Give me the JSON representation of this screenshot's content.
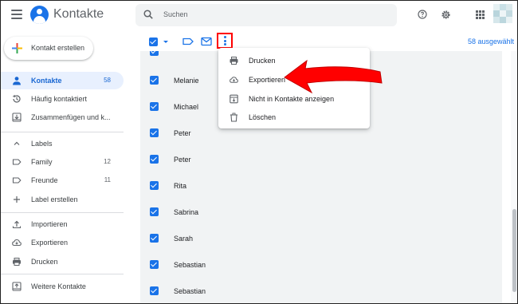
{
  "header": {
    "title": "Kontakte",
    "search_placeholder": "Suchen",
    "icons": [
      "menu-icon",
      "contacts-logo",
      "search-icon",
      "help-icon",
      "gear-icon",
      "apps-icon",
      "avatar"
    ]
  },
  "sidebar": {
    "create_label": "Kontakt erstellen",
    "items": [
      {
        "label": "Kontakte",
        "count": "58",
        "icon": "person-icon",
        "active": true
      },
      {
        "label": "Häufig kontaktiert",
        "count": "",
        "icon": "history-icon"
      },
      {
        "label": "Zusammenfügen und k...",
        "count": "",
        "icon": "merge-icon"
      },
      {
        "label": "Labels",
        "count": "",
        "icon": "chevron-up-icon"
      },
      {
        "label": "Family",
        "count": "12",
        "icon": "label-icon"
      },
      {
        "label": "Freunde",
        "count": "11",
        "icon": "label-icon"
      },
      {
        "label": "Label erstellen",
        "count": "",
        "icon": "plus-icon"
      },
      {
        "label": "Importieren",
        "count": "",
        "icon": "upload-icon"
      },
      {
        "label": "Exportieren",
        "count": "",
        "icon": "cloud-download-icon"
      },
      {
        "label": "Drucken",
        "count": "",
        "icon": "print-icon"
      },
      {
        "label": "Weitere Kontakte",
        "count": "",
        "icon": "other-contacts-icon"
      }
    ]
  },
  "toolbar": {
    "selected_text": "58 ausgewählt"
  },
  "contacts": [
    {
      "name": "Melanie"
    },
    {
      "name": "Michael"
    },
    {
      "name": "Peter"
    },
    {
      "name": "Peter"
    },
    {
      "name": "Rita"
    },
    {
      "name": "Sabrina"
    },
    {
      "name": "Sarah"
    },
    {
      "name": "Sebastian"
    },
    {
      "name": "Sebastian"
    }
  ],
  "menu": {
    "items": [
      {
        "label": "Drucken",
        "icon": "print-icon"
      },
      {
        "label": "Exportieren",
        "icon": "cloud-download-icon"
      },
      {
        "label": "Nicht in Kontakte anzeigen",
        "icon": "archive-icon"
      },
      {
        "label": "Löschen",
        "icon": "trash-icon"
      }
    ]
  },
  "colors": {
    "accent": "#1a73e8",
    "active_bg": "#e8f0fe",
    "annotation_red": "#ff0000",
    "list_bg": "#f1f3f4"
  }
}
